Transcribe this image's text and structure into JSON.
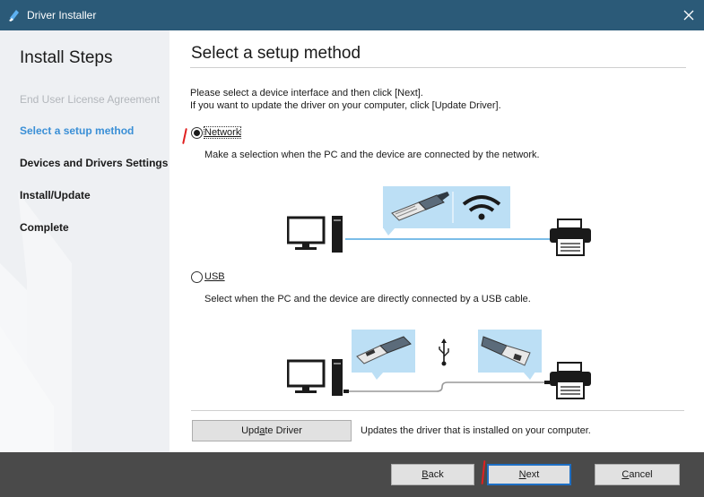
{
  "window": {
    "title": "Driver Installer"
  },
  "sidebar": {
    "heading": "Install Steps",
    "steps": [
      {
        "label": "End User License Agreement",
        "state": "done"
      },
      {
        "label": "Select a setup method",
        "state": "current"
      },
      {
        "label": "Devices and Drivers Settings",
        "state": "pending"
      },
      {
        "label": "Install/Update",
        "state": "pending"
      },
      {
        "label": "Complete",
        "state": "pending"
      }
    ]
  },
  "main": {
    "title": "Select a setup method",
    "intro_line1": "Please select a device interface and then click [Next].",
    "intro_line2": "If you want to update the driver on your computer, click [Update Driver].",
    "options": {
      "network": {
        "label": "Network",
        "checked": true,
        "description": "Make a selection when the PC and the device are connected by the network."
      },
      "usb": {
        "label": "USB",
        "checked": false,
        "description": "Select when the PC and the device are directly connected by a USB cable."
      }
    },
    "update_button": {
      "label_pre": "Upd",
      "label_key": "a",
      "label_post": "te Driver"
    },
    "update_description": "Updates the driver that is installed on your computer."
  },
  "footer": {
    "back": {
      "key": "B",
      "rest": "ack"
    },
    "next": {
      "key": "N",
      "rest": "ext"
    },
    "cancel": {
      "key": "C",
      "rest": "ancel"
    }
  },
  "colors": {
    "titlebar": "#2b5a78",
    "current_step": "#3a8fd6",
    "panel": "#bcdff5",
    "footer": "#4a4a4a"
  }
}
